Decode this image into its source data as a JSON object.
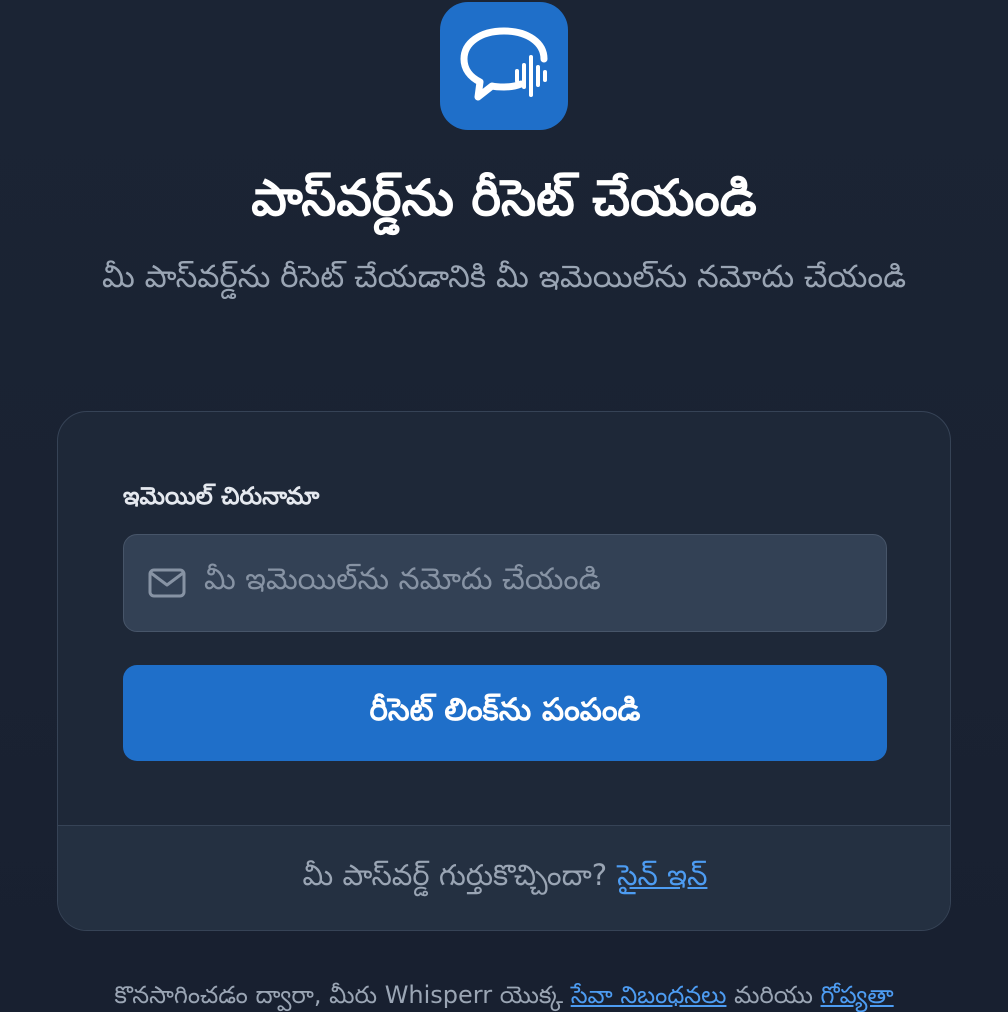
{
  "brand": {
    "icon": "chat-bubble-waveform-icon",
    "color": "#1f6fc9"
  },
  "header": {
    "title": "పాస్‌వర్డ్‌ను రీసెట్ చేయండి",
    "subtitle": "మీ పాస్‌వర్డ్‌ను రీసెట్ చేయడానికి మీ ఇమెయిల్‌ను నమోదు చేయండి"
  },
  "form": {
    "email_label": "ఇమెయిల్ చిరునామా",
    "email_placeholder": "మీ ఇమెయిల్‌ను నమోదు చేయండి",
    "email_icon": "mail-icon",
    "email_value": "",
    "submit_label": "రీసెట్ లింక్‌ను పంపండి"
  },
  "card_footer": {
    "prompt": "మీ పాస్‌వర్డ్ గుర్తుకొచ్చిందా?",
    "signin_link": "సైన్ ఇన్"
  },
  "legal": {
    "prefix": "కొనసాగించడం ద్వారా, మీరు Whisperr యొక్క",
    "terms_link": "సేవా నిబంధనలు",
    "and": "మరియు",
    "privacy_link": "గోప్యతా"
  },
  "colors": {
    "background": "#1a2232",
    "card": "#1e2838",
    "input": "#334155",
    "accent": "#1f6fc9",
    "link": "#4d9cf2"
  }
}
